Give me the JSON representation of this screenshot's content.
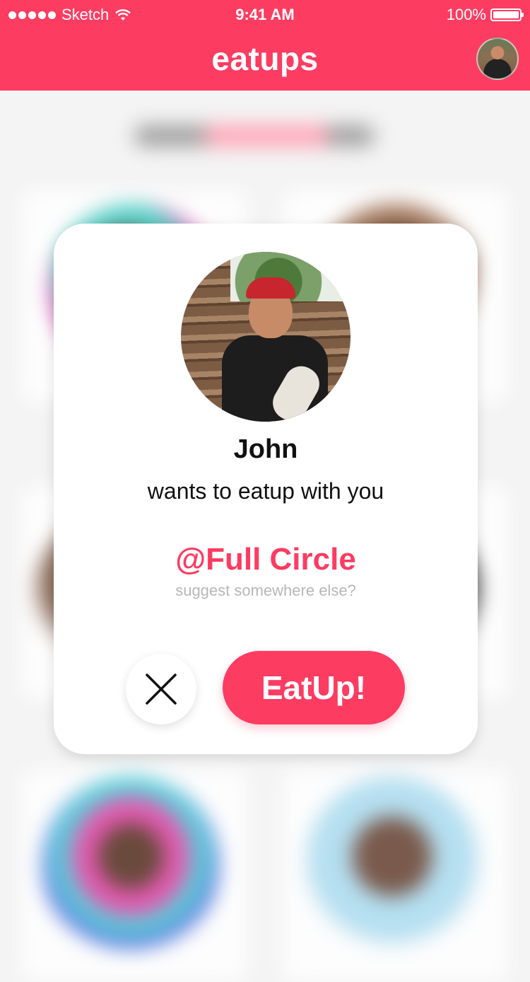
{
  "status_bar": {
    "carrier": "Sketch",
    "time": "9:41 AM",
    "battery": "100%"
  },
  "nav": {
    "title": "eatups",
    "avatar_icon": "profile-avatar"
  },
  "invite": {
    "name": "John",
    "message": "wants to eatup with you",
    "place": "@Full Circle",
    "suggest_link": "suggest somewhere else?",
    "decline_icon": "close-icon",
    "accept_label": "EatUp!"
  },
  "colors": {
    "accent": "#fd3c62",
    "muted": "#b7b7b7"
  }
}
